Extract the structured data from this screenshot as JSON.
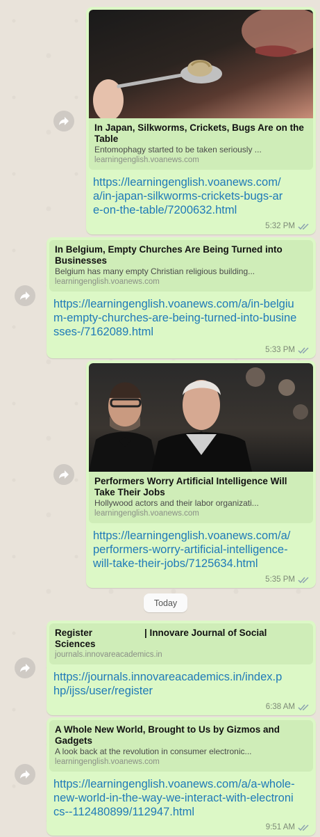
{
  "messages": [
    {
      "preview_title": "In Japan, Silkworms, Crickets, Bugs Are on the Table",
      "preview_desc": "Entomophagy started to be taken seriously ...",
      "preview_domain": "learningenglish.voanews.com",
      "link": "https://learningenglish.voanews.com/a/in-japan-silkworms-crickets-bugs-are-on-the-table/7200632.html",
      "time": "5:32 PM"
    },
    {
      "preview_title": "In Belgium, Empty Churches Are Being Turned into Businesses",
      "preview_desc": "Belgium has many empty Christian religious building...",
      "preview_domain": "learningenglish.voanews.com",
      "link": "https://learningenglish.voanews.com/a/in-belgium-empty-churches-are-being-turned-into-businesses-/7162089.html",
      "time": "5:33 PM"
    },
    {
      "preview_title": "Performers Worry Artificial Intelligence Will Take Their Jobs",
      "preview_desc": "Hollywood actors and their labor organizati...",
      "preview_domain": "learningenglish.voanews.com",
      "link": "https://learningenglish.voanews.com/a/performers-worry-artificial-intelligence-will-take-their-jobs/7125634.html",
      "time": "5:35 PM"
    },
    {
      "preview_title": "Register                    | Innovare Journal of Social Sciences",
      "preview_domain": "journals.innovareacademics.in",
      "link": "https://journals.innovareacademics.in/index.php/ijss/user/register",
      "time": "6:38 AM"
    },
    {
      "preview_title": "A Whole New World, Brought to Us by Gizmos and Gadgets",
      "preview_desc": "A look back at the revolution in consumer electronic...",
      "preview_domain": "learningenglish.voanews.com",
      "link": "https://learningenglish.voanews.com/a/a-whole-new-world-in-the-way-we-interact-with-electronics--112480899/112947.html",
      "time": "9:51 AM"
    }
  ],
  "date_separator": "Today",
  "colors": {
    "bubble": "#dcf8c6",
    "preview": "#cfedb8",
    "link": "#1f7ab8",
    "background": "#e9e3da"
  },
  "icons": {
    "forward": "forward-icon",
    "read_receipt": "double-check-icon"
  }
}
